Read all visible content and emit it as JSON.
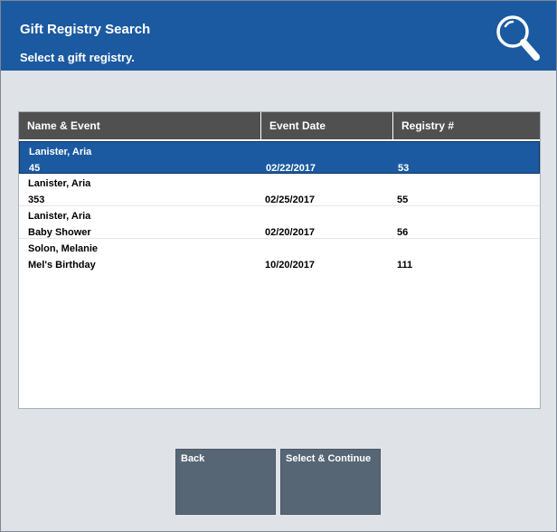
{
  "header": {
    "title": "Gift Registry Search",
    "subtitle": "Select a gift registry.",
    "icon": "search-icon"
  },
  "table": {
    "columns": [
      "Name & Event",
      "Event Date",
      "Registry #"
    ],
    "rows": [
      {
        "name": "Lanister, Aria",
        "event": "45",
        "date": "02/22/2017",
        "registry": "53",
        "selected": true
      },
      {
        "name": "Lanister, Aria",
        "event": "353",
        "date": "02/25/2017",
        "registry": "55",
        "selected": false
      },
      {
        "name": "Lanister, Aria",
        "event": "Baby Shower",
        "date": "02/20/2017",
        "registry": "56",
        "selected": false
      },
      {
        "name": "Solon, Melanie",
        "event": "Mel's Birthday",
        "date": "10/20/2017",
        "registry": "111",
        "selected": false
      }
    ]
  },
  "buttons": {
    "back": "Back",
    "select_continue": "Select & Continue"
  },
  "colors": {
    "header": "#1b5aa0",
    "selected_row": "#1b5aa0",
    "column_header": "#505050",
    "button": "#576675",
    "background": "#dfe2e7"
  }
}
